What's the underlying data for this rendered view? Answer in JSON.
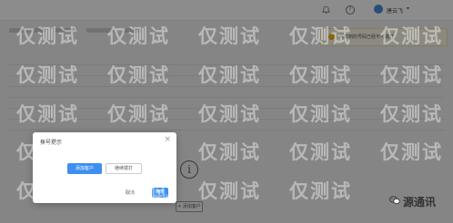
{
  "topbar": {
    "bell_icon": "bell-icon",
    "help_glyph": "?",
    "username": "唐云飞",
    "chevron": "▾"
  },
  "toast": {
    "icon_glyph": "!",
    "text": "共享到的号码已经不可拨打"
  },
  "dialog": {
    "title": "拨号提示",
    "close_glyph": "×",
    "primary_option": "添加客户",
    "secondary_option": "继续拨打",
    "cancel_label": "取消",
    "ok_label": "确定"
  },
  "main": {
    "empty_glyph": "i",
    "add_client_label": "+ 添加客户"
  },
  "watermark": {
    "text": "仅测试"
  },
  "brand": {
    "name": "源通讯"
  },
  "colors": {
    "primary": "#3d8ff0",
    "warning": "#f5b400",
    "brand_green": "#2a9d4a"
  }
}
